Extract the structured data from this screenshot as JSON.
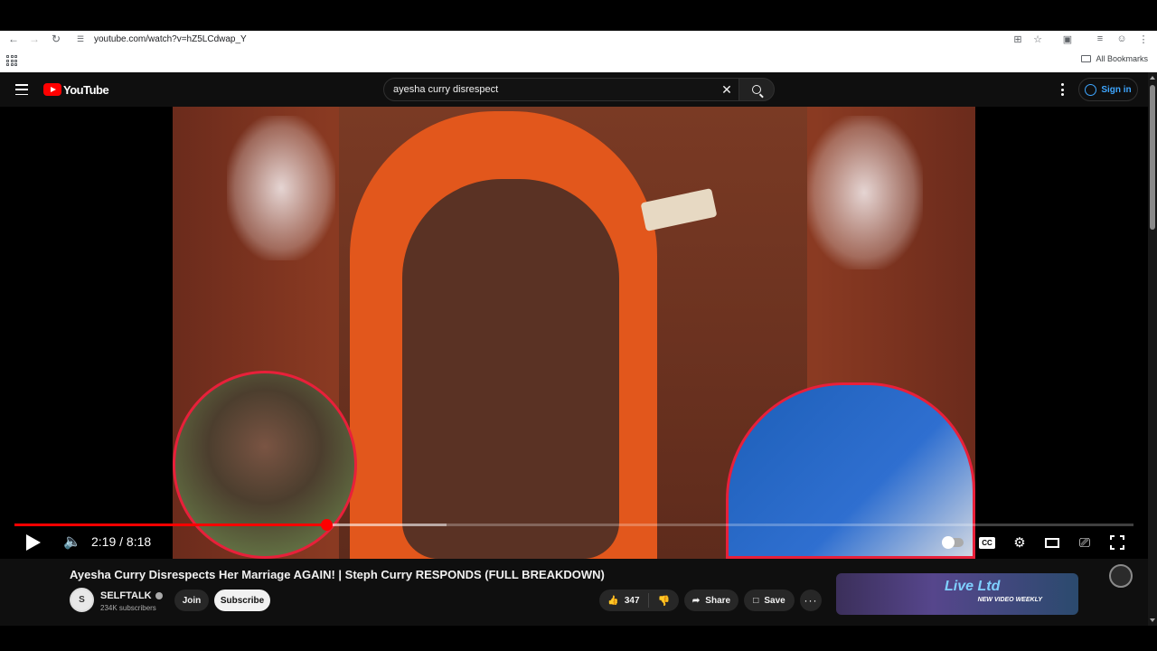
{
  "browser": {
    "url": "youtube.com/watch?v=hZ5LCdwap_Y",
    "all_bookmarks": "All Bookmarks"
  },
  "youtube": {
    "logo_text": "YouTube",
    "search_value": "ayesha curry disrespect",
    "sign_in": "Sign in"
  },
  "player": {
    "time": "2:19 / 8:18",
    "progress_fraction": 0.279,
    "buffered_fraction": 0.386
  },
  "video": {
    "title": "Ayesha Curry Disrespects Her Marriage AGAIN! | Steph Curry RESPONDS (FULL BREAKDOWN)",
    "channel_name": "SELFTALK",
    "subscribers": "234K subscribers",
    "join": "Join",
    "subscribe": "Subscribe",
    "likes": "347",
    "share": "Share",
    "save": "Save"
  },
  "recommendation": {
    "thumb_text": "NEW VIDEO WEEKLY",
    "thumb_script": "Live Ltd"
  },
  "colors": {
    "accent": "#ff0000",
    "link": "#3ea6ff",
    "background": "#0f0f0f"
  }
}
